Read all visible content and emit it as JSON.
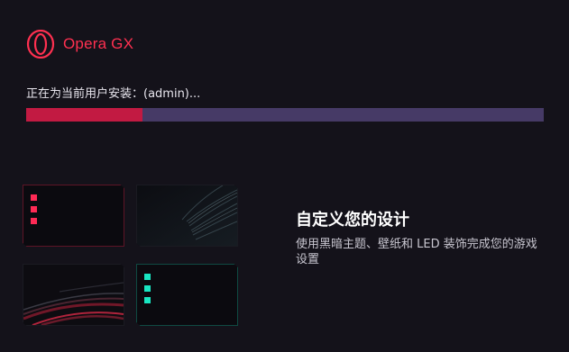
{
  "brand": {
    "name": "Opera GX",
    "logo_icon": "opera-gx-logo-icon",
    "accent": "#ff3050"
  },
  "install": {
    "status_text": "正在为当前用户安装：(admin)...",
    "progress": 0.225,
    "progress_color": "#c21a42",
    "track_color": "#463a66"
  },
  "feature": {
    "heading": "自定义您的设计",
    "description": "使用黑暗主题、壁纸和 LED 装饰完成您的游戏设置"
  },
  "preview_cards": [
    {
      "name": "red-led-theme-card",
      "style": "dark-led",
      "led_color": "#ff2a55"
    },
    {
      "name": "dark-streaks-wallpaper-card",
      "style": "wallpaper-streaks"
    },
    {
      "name": "red-speed-wallpaper-card",
      "style": "wallpaper-red"
    },
    {
      "name": "teal-led-theme-card",
      "style": "dark-led",
      "led_color": "#19e6c2"
    }
  ]
}
